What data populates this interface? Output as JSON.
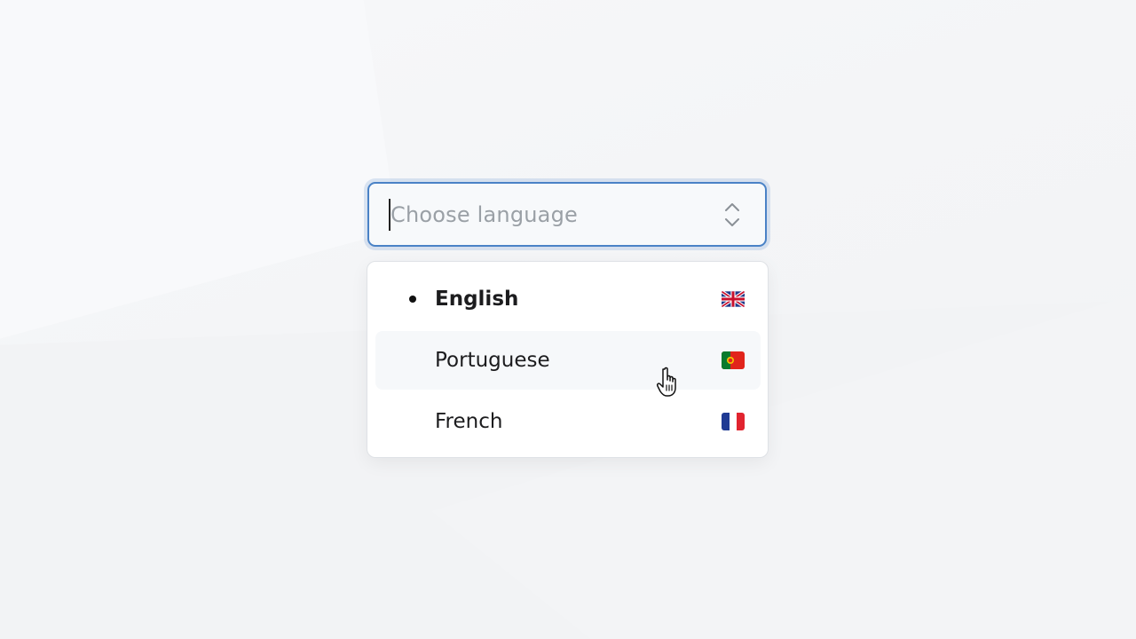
{
  "select": {
    "placeholder": "Choose language",
    "value": ""
  },
  "options": [
    {
      "label": "English",
      "selected": true,
      "flag": "uk-flag-icon"
    },
    {
      "label": "Portuguese",
      "selected": false,
      "hovered": true,
      "flag": "portugal-flag-icon"
    },
    {
      "label": "French",
      "selected": false,
      "flag": "france-flag-icon"
    }
  ],
  "colors": {
    "focus_border": "#4a82c6",
    "background": "#f2f4f6",
    "option_hover": "#f6f8fa"
  }
}
